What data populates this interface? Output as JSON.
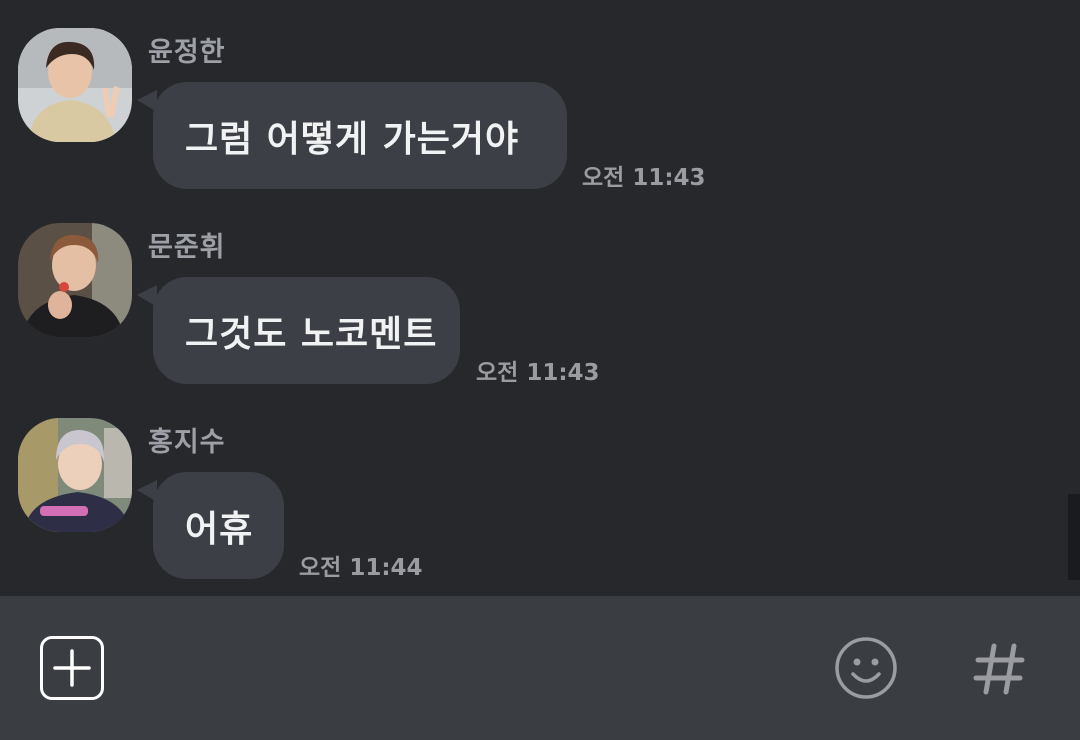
{
  "messages": [
    {
      "sender": "윤정한",
      "text": "그럼 어떻게 가는거야",
      "time": "오전 11:43",
      "avatar_icon": "profile-photo-icon"
    },
    {
      "sender": "문준휘",
      "text": "그것도 노코멘트",
      "time": "오전 11:43",
      "avatar_icon": "profile-photo-icon"
    },
    {
      "sender": "홍지수",
      "text": "어휴",
      "time": "오전 11:44",
      "avatar_icon": "profile-photo-icon"
    }
  ],
  "input_bar": {
    "plus_icon": "plus-icon",
    "emoji_icon": "smiley-icon",
    "hash_icon": "hash-icon"
  },
  "colors": {
    "background": "#26282c",
    "bubble": "#3c3f45",
    "input_bar": "#3a3d42",
    "name_text": "#9da0a6",
    "message_text": "#f1f2f3"
  }
}
